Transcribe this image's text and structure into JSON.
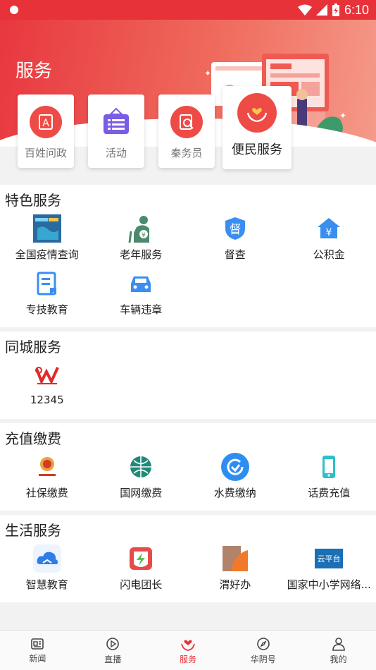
{
  "status_bar": {
    "time": "6:10",
    "battery_icon": "battery-charging-icon",
    "wifi_icon": "wifi-icon",
    "signal_icon": "signal-icon"
  },
  "header": {
    "title": "服务"
  },
  "quick_cards": [
    {
      "label": "百姓问政",
      "icon": "question-a-icon",
      "color": "#ee4b46"
    },
    {
      "label": "活动",
      "icon": "event-board-icon",
      "color": "#7b5ce6"
    },
    {
      "label": "秦务员",
      "icon": "document-search-icon",
      "color": "#ee4b46"
    },
    {
      "label": "便民服务",
      "icon": "heart-hands-icon",
      "color": "#ee4b46"
    }
  ],
  "sections": {
    "featured": {
      "title": "特色服务",
      "items": [
        {
          "label": "全国疫情查询",
          "icon": "epidemic-map-icon"
        },
        {
          "label": "老年服务",
          "icon": "elderly-icon"
        },
        {
          "label": "督查",
          "icon": "supervision-badge-icon"
        },
        {
          "label": "公积金",
          "icon": "housing-fund-icon"
        },
        {
          "label": "专技教育",
          "icon": "education-doc-icon"
        },
        {
          "label": "车辆违章",
          "icon": "car-icon"
        }
      ]
    },
    "city": {
      "title": "同城服务",
      "items": [
        {
          "label": "12345",
          "icon": "hotline-logo-icon"
        }
      ]
    },
    "payment": {
      "title": "充值缴费",
      "items": [
        {
          "label": "社保缴费",
          "icon": "tax-emblem-icon"
        },
        {
          "label": "国网缴费",
          "icon": "state-grid-icon"
        },
        {
          "label": "水费缴纳",
          "icon": "water-bill-icon"
        },
        {
          "label": "话费充值",
          "icon": "phone-icon"
        }
      ]
    },
    "life": {
      "title": "生活服务",
      "items": [
        {
          "label": "智慧教育",
          "icon": "cloud-book-icon"
        },
        {
          "label": "闪电团长",
          "icon": "lightning-bag-icon"
        },
        {
          "label": "渭好办",
          "icon": "weihaoban-icon"
        },
        {
          "label": "国家中小学网络...",
          "icon": "cloud-platform-icon"
        }
      ]
    }
  },
  "bottom_nav": [
    {
      "label": "新闻",
      "icon": "news-icon"
    },
    {
      "label": "直播",
      "icon": "play-icon"
    },
    {
      "label": "服务",
      "icon": "service-heart-icon",
      "active": true
    },
    {
      "label": "华阴号",
      "icon": "compass-icon"
    },
    {
      "label": "我的",
      "icon": "user-icon"
    }
  ],
  "colors": {
    "brand_red": "#e8323a",
    "accent_blue": "#3a8ef0"
  }
}
